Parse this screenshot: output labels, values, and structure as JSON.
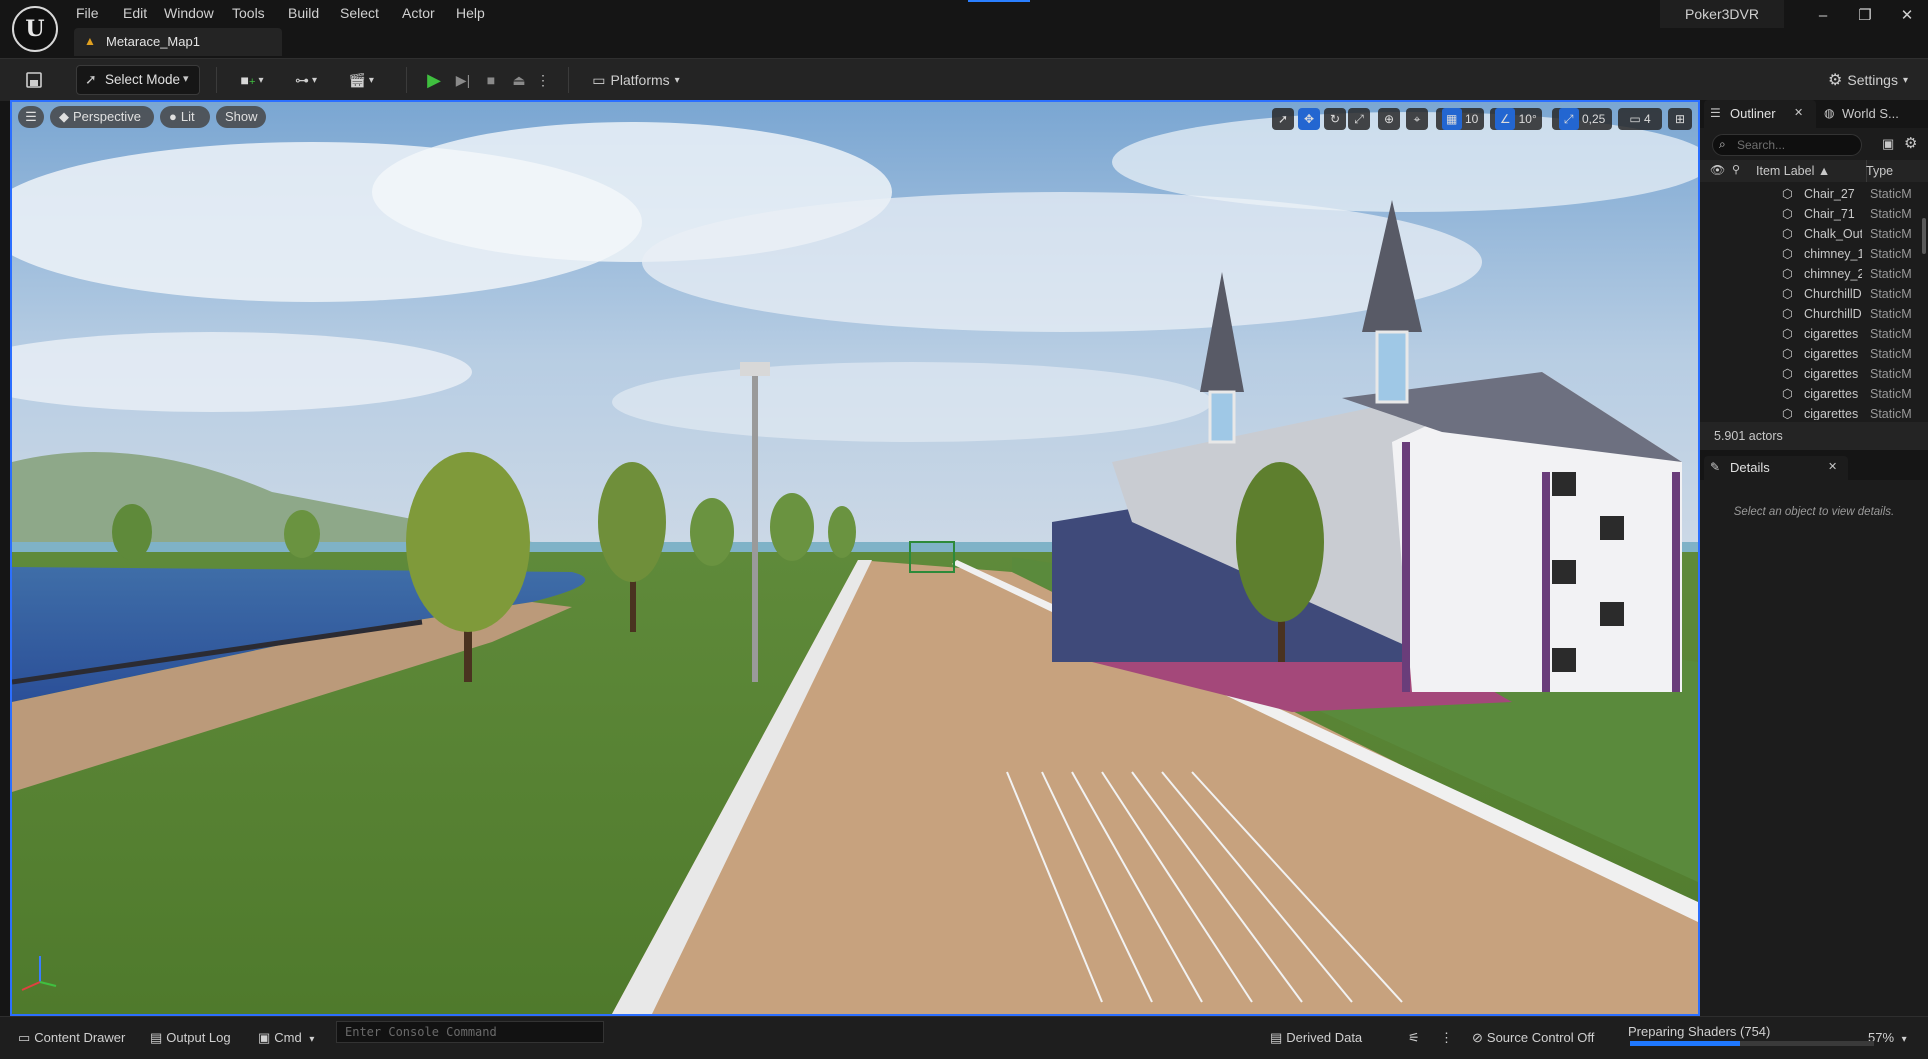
{
  "app": {
    "logo_glyph": "U",
    "project_name": "Poker3DVR"
  },
  "menu": [
    "File",
    "Edit",
    "Window",
    "Tools",
    "Build",
    "Select",
    "Actor",
    "Help"
  ],
  "document_tab": {
    "label": "Metarace_Map1"
  },
  "window_controls": {
    "minimize": "–",
    "restore": "❐",
    "close": "✕"
  },
  "toolbar": {
    "select_mode": "Select Mode",
    "platforms": "Platforms",
    "settings": "Settings"
  },
  "viewport": {
    "view_mode": "Perspective",
    "lighting": "Lit",
    "show": "Show",
    "grid_snap": "10",
    "rotation_snap": "10°",
    "scale_snap": "0,25",
    "camera_speed": "4"
  },
  "outliner": {
    "tab_label": "Outliner",
    "world_tab_label": "World S...",
    "search_placeholder": "Search...",
    "col_label": "Item Label ▲",
    "col_type": "Type",
    "rows": [
      {
        "label": "Chair_27",
        "type": "StaticM"
      },
      {
        "label": "Chair_71",
        "type": "StaticM"
      },
      {
        "label": "Chalk_Out",
        "type": "StaticM"
      },
      {
        "label": "chimney_1",
        "type": "StaticM"
      },
      {
        "label": "chimney_2",
        "type": "StaticM"
      },
      {
        "label": "ChurchillD",
        "type": "StaticM"
      },
      {
        "label": "ChurchillD",
        "type": "StaticM"
      },
      {
        "label": "cigarettes",
        "type": "StaticM"
      },
      {
        "label": "cigarettes",
        "type": "StaticM"
      },
      {
        "label": "cigarettes",
        "type": "StaticM"
      },
      {
        "label": "cigarettes",
        "type": "StaticM"
      },
      {
        "label": "cigarettes",
        "type": "StaticM"
      }
    ],
    "actor_count": "5.901 actors"
  },
  "details": {
    "tab_label": "Details",
    "empty_message": "Select an object to view details."
  },
  "statusbar": {
    "content_drawer": "Content Drawer",
    "output_log": "Output Log",
    "cmd": "Cmd",
    "console_placeholder": "Enter Console Command",
    "derived_data": "Derived Data",
    "source_control": "Source Control Off",
    "shaders": "Preparing Shaders (754)",
    "shader_progress": 0.45,
    "zoom": "57%"
  },
  "colors": {
    "accent": "#2c6fff",
    "play_green": "#3fbf3f"
  }
}
